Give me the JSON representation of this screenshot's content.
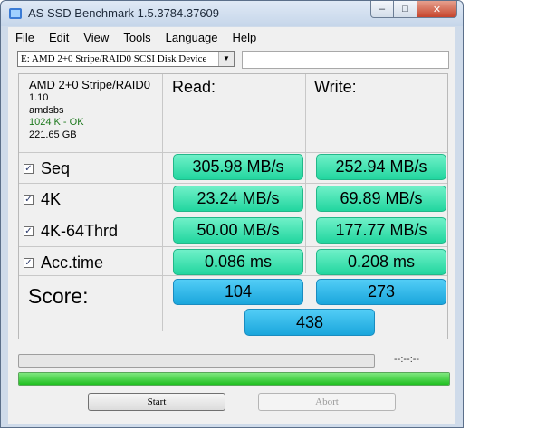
{
  "window": {
    "title": "AS SSD Benchmark 1.5.3784.37609"
  },
  "menu": [
    "File",
    "Edit",
    "View",
    "Tools",
    "Language",
    "Help"
  ],
  "drive": {
    "selected": "E: AMD 2+0 Stripe/RAID0 SCSI Disk Device"
  },
  "info": {
    "name": "AMD 2+0 Stripe/RAID0",
    "firmware": "1.10",
    "driver": "amdsbs",
    "alignment": "1024 K - OK",
    "size": "221.65 GB"
  },
  "headers": {
    "read": "Read:",
    "write": "Write:"
  },
  "rows": [
    {
      "label": "Seq",
      "checked": true,
      "read": "305.98 MB/s",
      "write": "252.94 MB/s"
    },
    {
      "label": "4K",
      "checked": true,
      "read": "23.24 MB/s",
      "write": "69.89 MB/s"
    },
    {
      "label": "4K-64Thrd",
      "checked": true,
      "read": "50.00 MB/s",
      "write": "177.77 MB/s"
    },
    {
      "label": "Acc.time",
      "checked": true,
      "read": "0.086 ms",
      "write": "0.208 ms"
    }
  ],
  "score": {
    "label": "Score:",
    "read": "104",
    "write": "273",
    "total": "438"
  },
  "progress": {
    "time": "--:--:--",
    "overall_fraction": 1.0
  },
  "buttons": {
    "start": "Start",
    "abort": "Abort"
  },
  "colors": {
    "result_cell": "#3ee3b1",
    "score_cell": "#2bb6e8",
    "progress_fill": "#2fcf2f"
  }
}
